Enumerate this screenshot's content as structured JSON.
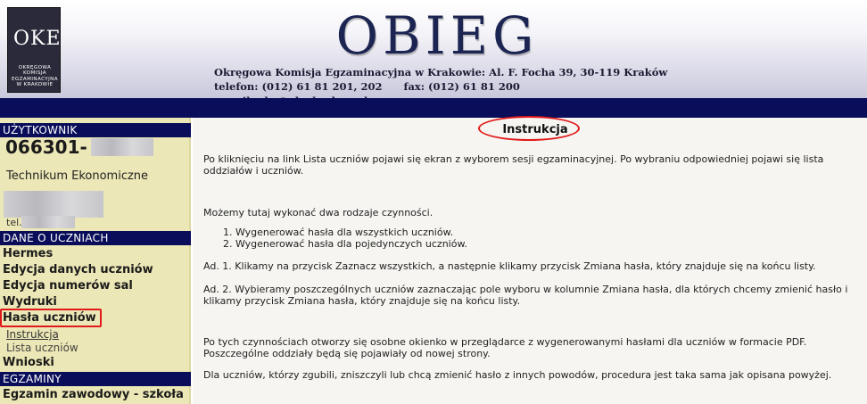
{
  "header": {
    "title": "OBIEG",
    "logo_mark": "OKE",
    "logo_text": "OKRĘGOWA KOMISJA EGZAMINACYJNA W KRAKOWIE",
    "address": "Okręgowa Komisja Egzaminacyjna w Krakowie: Al. F. Focha 39, 30-119 Kraków",
    "phone": "telefon: (012) 61 81 201, 202",
    "fax": "fax: (012) 61 81 200",
    "email": "e-mail: oke@oke.krakow.pl"
  },
  "sidebar": {
    "user_header": "UŻYTKOWNIK",
    "user_code": "066301-",
    "school": "Technikum Ekonomiczne",
    "tel_label": "tel.",
    "students_header": "DANE O UCZNIACH",
    "items": [
      {
        "label": "Hermes"
      },
      {
        "label": "Edycja danych uczniów"
      },
      {
        "label": "Edycja numerów sal"
      },
      {
        "label": "Wydruki"
      },
      {
        "label": "Hasła uczniów"
      }
    ],
    "subitems": [
      {
        "label": "Instrukcja"
      },
      {
        "label": "Lista uczniów"
      }
    ],
    "wnioski": "Wnioski",
    "exams_header": "EGZAMINY",
    "exam_item": "Egzamin zawodowy - szkoła"
  },
  "main": {
    "title": "Instrukcja",
    "p1": "Po kliknięciu na link Lista uczniów pojawi się ekran z wyborem sesji egzaminacyjnej. Po wybraniu odpowiedniej pojawi się lista oddziałów i uczniów.",
    "p2": "Możemy tutaj wykonać dwa rodzaje czynności.",
    "li1": "1.  Wygenerować hasła dla wszystkich uczniów.",
    "li2": "2.  Wygenerować hasła dla pojedynczych uczniów.",
    "p3": "Ad. 1. Klikamy na przycisk Zaznacz wszystkich, a następnie klikamy przycisk Zmiana hasła, który znajduje się na końcu listy.",
    "p4": "Ad. 2. Wybieramy poszczególnych uczniów zaznaczając pole wyboru w kolumnie Zmiana hasła, dla których chcemy zmienić hasło i klikamy przycisk Zmiana hasła, który znajduje się na końcu listy.",
    "p5": "Po tych czynnościach otworzy się osobne okienko w przeglądarce z wygenerowanymi hasłami dla uczniów w formacie PDF. Poszczególne oddziały będą się pojawiały od nowej strony.",
    "p6": "Dla uczniów, którzy zgubili, zniszczyli lub chcą zmienić hasło z innych powodów, procedura jest taka sama jak opisana powyżej."
  },
  "colors": {
    "navy": "#0a0e5a",
    "sidebar_bg": "#ece7b6",
    "highlight_red": "#e01a1a"
  }
}
